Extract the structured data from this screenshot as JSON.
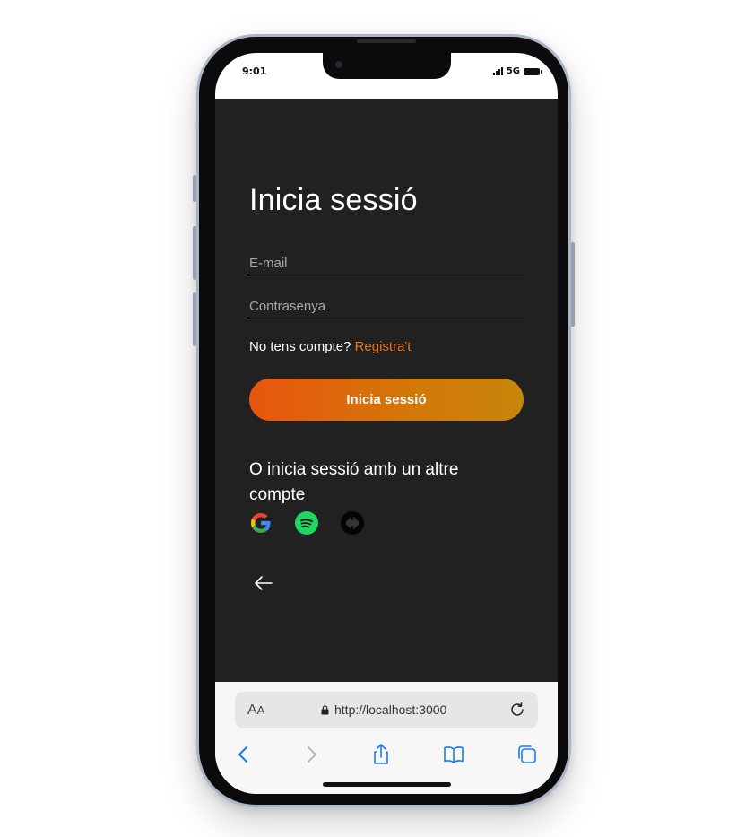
{
  "status_bar": {
    "time": "9:01",
    "network": "5G"
  },
  "login": {
    "title": "Inicia sessió",
    "email_placeholder": "E-mail",
    "password_placeholder": "Contrasenya",
    "signup_prompt": "No tens compte?",
    "signup_link": "Registra't",
    "submit_label": "Inicia sessió",
    "alt_title": "O inicia sessió amb un altre compte",
    "social_icons": [
      "google-icon",
      "spotify-icon",
      "audio-wave-icon"
    ],
    "accent_color": "#e8731b"
  },
  "browser": {
    "text_size_label": "A",
    "text_size_label_small": "A",
    "url": "http://localhost:3000",
    "toolbar_icons": [
      "back-icon",
      "forward-icon",
      "share-icon",
      "bookmarks-icon",
      "tabs-icon"
    ]
  }
}
